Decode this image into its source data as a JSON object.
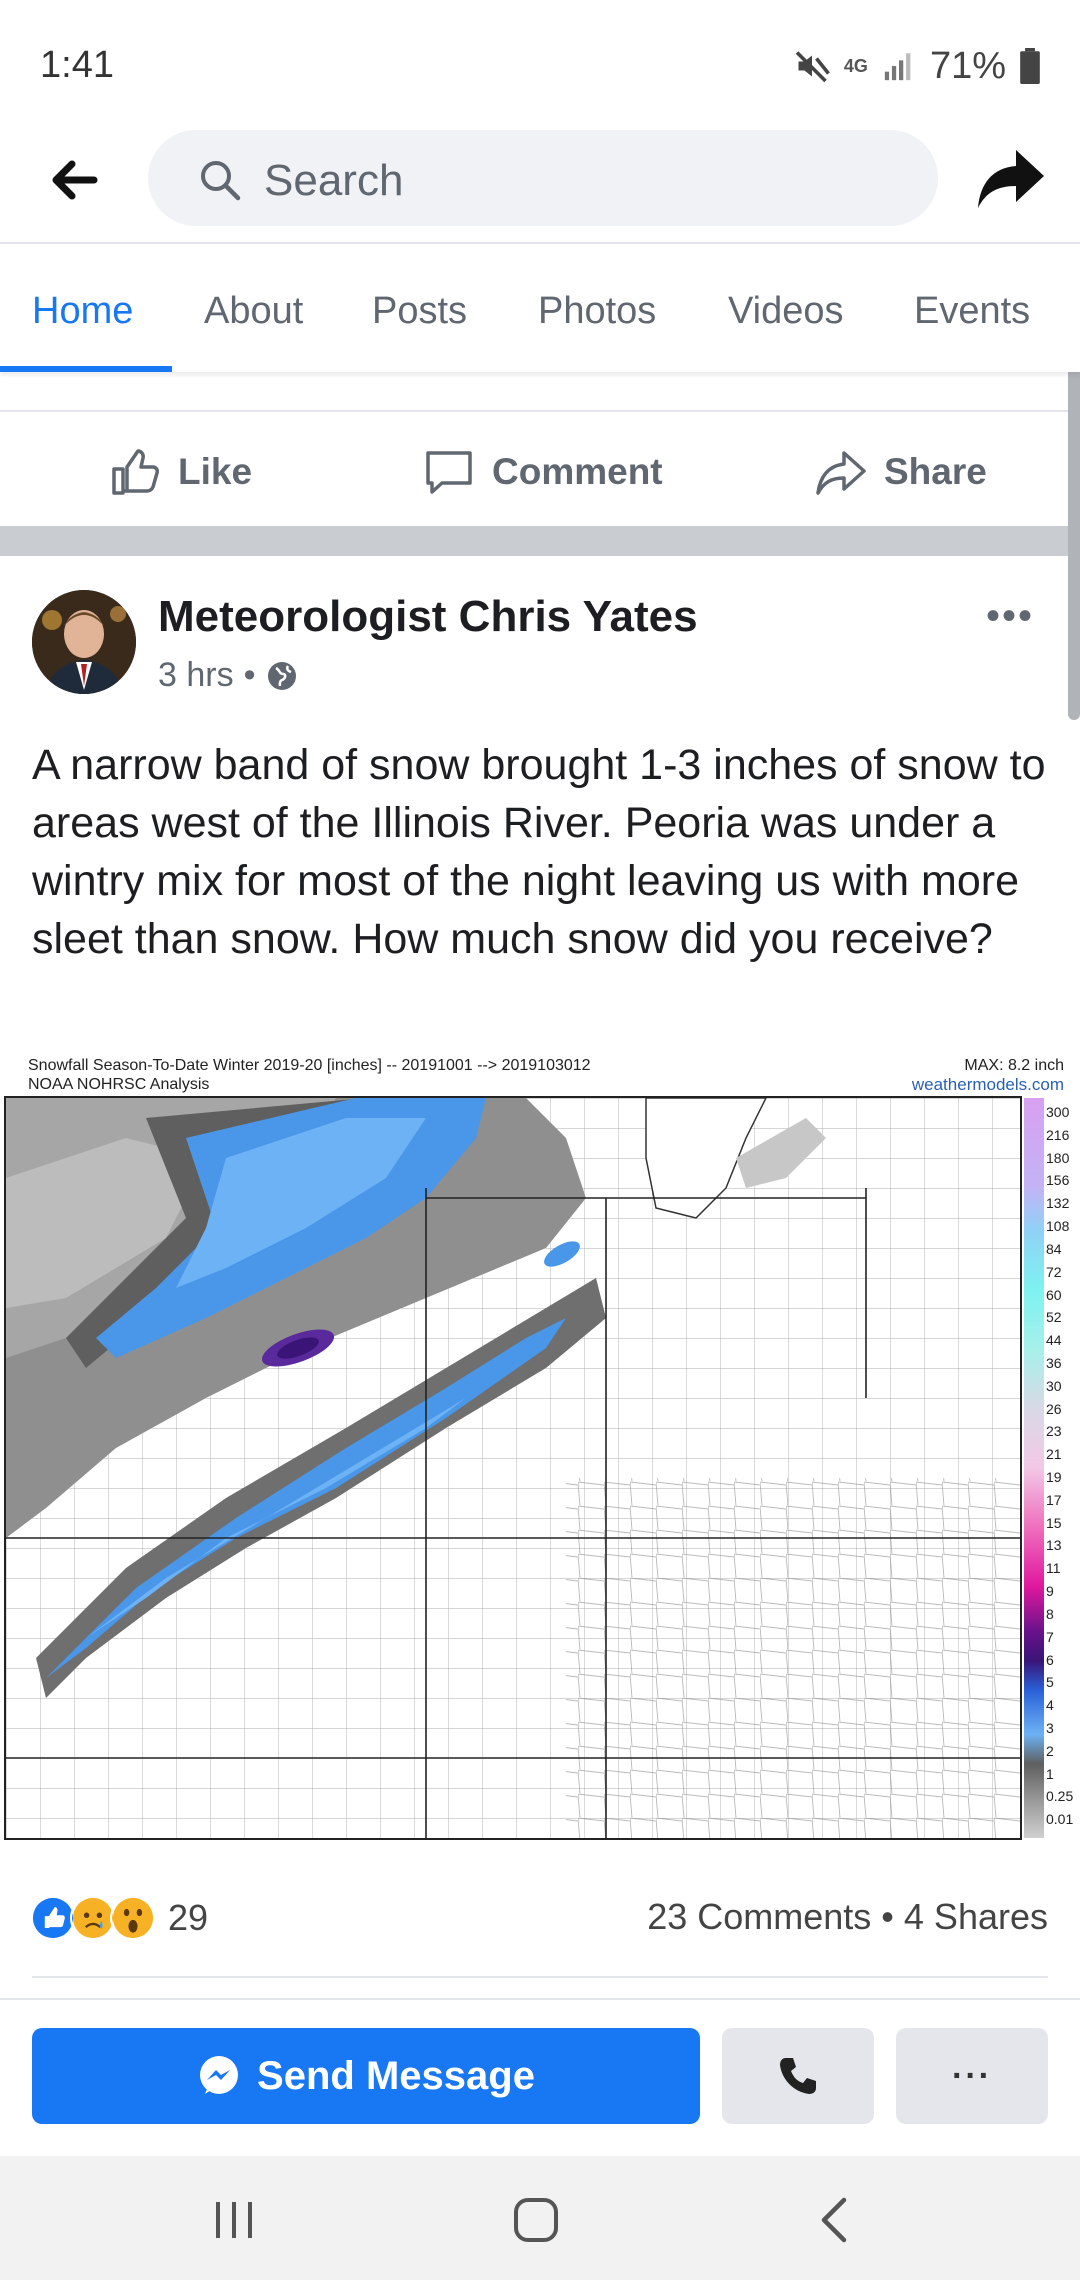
{
  "status_bar": {
    "time": "1:41",
    "network": "4G",
    "battery": "71%"
  },
  "header": {
    "search_placeholder": "Search"
  },
  "tabs": [
    {
      "label": "Home",
      "active": true
    },
    {
      "label": "About"
    },
    {
      "label": "Posts"
    },
    {
      "label": "Photos"
    },
    {
      "label": "Videos"
    },
    {
      "label": "Events"
    }
  ],
  "prev_post_actions": {
    "like": "Like",
    "comment": "Comment",
    "share": "Share"
  },
  "post": {
    "author": "Meteorologist Chris Yates",
    "time": "3 hrs",
    "visibility_icon": "globe-icon",
    "text": "A narrow band of snow brought 1-3 inches of snow to areas west of the Illinois River. Peoria was under a wintry mix for most of the night leaving us with more sleet than snow. How much snow did you receive?",
    "image": {
      "title_line1": "Snowfall Season-To-Date Winter 2019-20 [inches] -- 20191001 --> 2019103012",
      "title_line2": "NOAA NOHRSC Analysis",
      "max_label": "MAX: 8.2 inch",
      "site": "weathermodels.com",
      "legend": [
        "300",
        "216",
        "180",
        "156",
        "132",
        "108",
        "84",
        "72",
        "60",
        "52",
        "44",
        "36",
        "30",
        "26",
        "23",
        "21",
        "19",
        "17",
        "15",
        "13",
        "11",
        "9",
        "8",
        "7",
        "6",
        "5",
        "4",
        "3",
        "2",
        "1",
        "0.25",
        "0.01"
      ]
    },
    "reaction_count": "29",
    "stats": "23 Comments • 4 Shares"
  },
  "bottom_actions": {
    "send_message": "Send Message",
    "more": "···"
  },
  "colors": {
    "accent": "#1877f2",
    "divider": "#c9ccd1"
  }
}
